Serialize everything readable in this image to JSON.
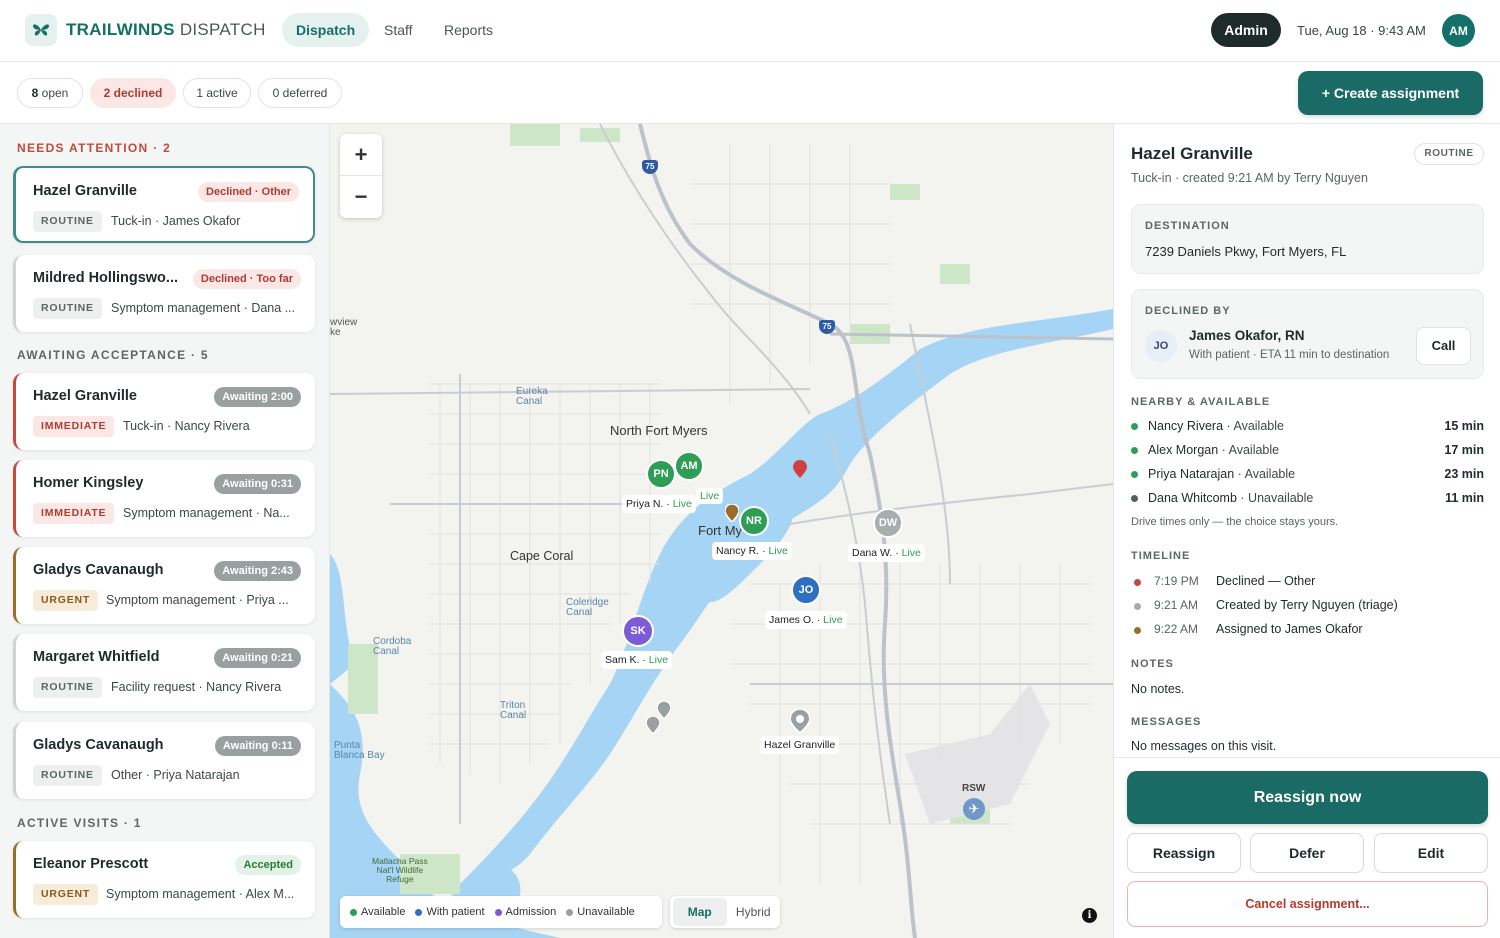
{
  "header": {
    "brand_primary": "TRAILWINDS",
    "brand_secondary": "DISPATCH",
    "tabs": [
      "Dispatch",
      "Staff",
      "Reports"
    ],
    "active_tab": "Dispatch",
    "role_label": "Admin",
    "datetime": "Tue, Aug 18 · 9:43 AM",
    "avatar_initials": "AM"
  },
  "filters": {
    "open": {
      "count": "8",
      "label": "open"
    },
    "declined": "2 declined",
    "active": "1 active",
    "deferred": "0 deferred"
  },
  "create_button": "+ Create assignment",
  "sections": {
    "needs_attention": "NEEDS ATTENTION · 2",
    "awaiting": "AWAITING ACCEPTANCE · 5",
    "active": "ACTIVE VISITS · 1"
  },
  "cards": [
    {
      "name": "Hazel Granville",
      "badge": "Declined · Other",
      "priority": "ROUTINE",
      "detail": "Tuck-in · James Okafor"
    },
    {
      "name": "Mildred Hollingswo...",
      "badge": "Declined · Too far",
      "priority": "ROUTINE",
      "detail": "Symptom management · Dana ..."
    },
    {
      "name": "Hazel Granville",
      "badge": "Awaiting 2:00",
      "priority": "IMMEDIATE",
      "detail": "Tuck-in · Nancy Rivera"
    },
    {
      "name": "Homer Kingsley",
      "badge": "Awaiting 0:31",
      "priority": "IMMEDIATE",
      "detail": "Symptom management · Na..."
    },
    {
      "name": "Gladys Cavanaugh",
      "badge": "Awaiting 2:43",
      "priority": "URGENT",
      "detail": "Symptom management · Priya ..."
    },
    {
      "name": "Margaret Whitfield",
      "badge": "Awaiting 0:21",
      "priority": "ROUTINE",
      "detail": "Facility request · Nancy Rivera"
    },
    {
      "name": "Gladys Cavanaugh",
      "badge": "Awaiting 0:11",
      "priority": "ROUTINE",
      "detail": "Other · Priya Natarajan"
    },
    {
      "name": "Eleanor Prescott",
      "badge": "Accepted",
      "priority": "URGENT",
      "detail": "Symptom management · Alex M..."
    }
  ],
  "map": {
    "zoom_in": "+",
    "zoom_out": "−",
    "place_labels": {
      "north_fort_myers": "North Fort Myers",
      "cape_coral": "Cape Coral",
      "fort_myers": "Fort My",
      "eureka": "Eureka\nCanal",
      "coleridge": "Coleridge\nCanal",
      "cordoba": "Cordoba\nCanal",
      "triton": "Triton\nCanal",
      "punta": "Punta\nBlanca Bay",
      "matlacha": "Matlacha Pass\nNat'l Wildlife\nRefuge",
      "rsw": "RSW",
      "wview": "wview\nke"
    },
    "highways": [
      "75",
      "75",
      "75"
    ],
    "staff_pins": [
      {
        "initials": "PN",
        "label": "Priya N.",
        "status": "Live"
      },
      {
        "initials": "AM",
        "label": "",
        "status": "Live"
      },
      {
        "initials": "NR",
        "label": "Nancy R.",
        "status": "Live"
      },
      {
        "initials": "DW",
        "label": "Dana W.",
        "status": "Live"
      },
      {
        "initials": "JO",
        "label": "James O.",
        "status": "Live"
      },
      {
        "initials": "SK",
        "label": "Sam K.",
        "status": "Live"
      }
    ],
    "patient_label": "Hazel Granville",
    "legend": [
      "Available",
      "With patient",
      "Admission",
      "Unavailable"
    ],
    "legend_colors": [
      "#2e9e57",
      "#2f6fc2",
      "#7b5bd6",
      "#9aa0a0"
    ],
    "map_types": [
      "Map",
      "Hybrid"
    ],
    "info": "i"
  },
  "detail": {
    "name": "Hazel Granville",
    "priority": "ROUTINE",
    "subtitle": "Tuck-in · created 9:21 AM by Terry Nguyen",
    "destination_label": "DESTINATION",
    "destination": "7239 Daniels Pkwy, Fort Myers, FL",
    "declined_by_label": "DECLINED BY",
    "declined_initials": "JO",
    "declined_name": "James Okafor, RN",
    "declined_status": "With patient · ETA 11 min to destination",
    "call_label": "Call",
    "nearby_label": "NEARBY & AVAILABLE",
    "nearby": [
      {
        "name": "Nancy Rivera",
        "status": "Available",
        "time": "15 min",
        "color": "#2e9e57"
      },
      {
        "name": "Alex Morgan",
        "status": "Available",
        "time": "17 min",
        "color": "#2e9e57"
      },
      {
        "name": "Priya Natarajan",
        "status": "Available",
        "time": "23 min",
        "color": "#2e9e57"
      },
      {
        "name": "Dana Whitcomb",
        "status": "Unavailable",
        "time": "11 min",
        "color": "#555e5e"
      }
    ],
    "nearby_note": "Drive times only — the choice stays yours.",
    "timeline_label": "TIMELINE",
    "timeline": [
      {
        "time": "7:19 PM",
        "event": "Declined — Other",
        "color": "#c24a3e"
      },
      {
        "time": "9:21 AM",
        "event": "Created by Terry Nguyen (triage)",
        "color": "#a6acac"
      },
      {
        "time": "9:22 AM",
        "event": "Assigned to James Okafor",
        "color": "#9a6d2a"
      }
    ],
    "notes_label": "NOTES",
    "notes": "No notes.",
    "messages_label": "MESSAGES",
    "messages": "No messages on this visit.",
    "actions": {
      "primary": "Reassign now",
      "reassign": "Reassign",
      "defer": "Defer",
      "edit": "Edit",
      "cancel": "Cancel assignment..."
    }
  }
}
